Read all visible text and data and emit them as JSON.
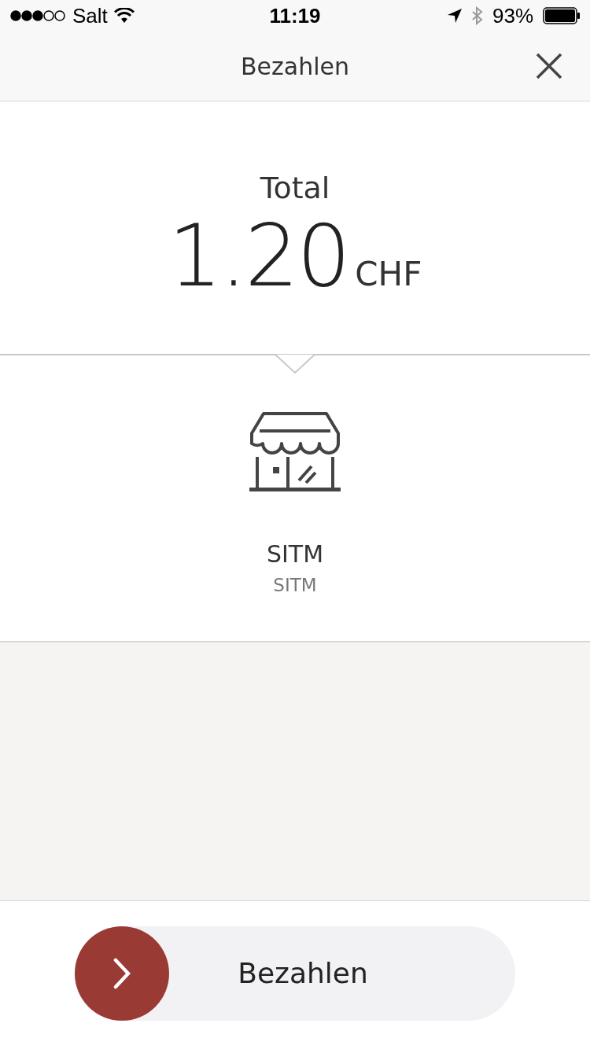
{
  "status_bar": {
    "carrier": "Salt",
    "time": "11:19",
    "battery": "93%"
  },
  "header": {
    "title": "Bezahlen"
  },
  "amount": {
    "label": "Total",
    "value": "1.20",
    "currency": "CHF"
  },
  "merchant": {
    "name": "SITM",
    "subtitle": "SITM"
  },
  "pay_slider": {
    "label": "Bezahlen",
    "level": 0
  }
}
